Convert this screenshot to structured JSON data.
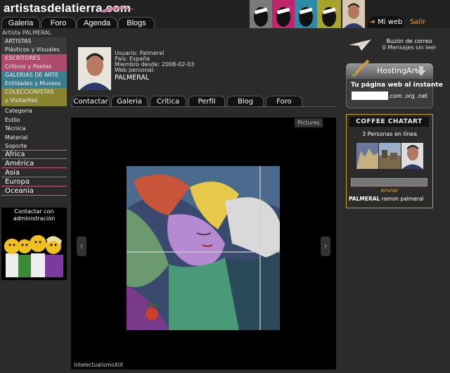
{
  "site": {
    "logo": "artistasdelatierra.com"
  },
  "topnav": [
    {
      "label": "Galeria"
    },
    {
      "label": "Foro"
    },
    {
      "label": "Agenda"
    },
    {
      "label": "Blogs"
    }
  ],
  "account": {
    "miweb_label": "Mi web",
    "salir_label": "Salir"
  },
  "breadcrumb": "Artista PALMERAL",
  "sections": [
    {
      "title": "ARTISTAS",
      "sub": "Plásticos y Visuales",
      "color": "#3a3a3a"
    },
    {
      "title": "ESCRITORES",
      "sub": "Críticos y Poetas",
      "color": "#b04a6e"
    },
    {
      "title": "GALERIAS DE ARTE",
      "sub": "Entidades y Museos",
      "color": "#3a7d8e"
    },
    {
      "title": "COLECCIONISTAS",
      "sub": "y Visitantes",
      "color": "#8a8430"
    }
  ],
  "filters": [
    "Categoria",
    "Estilo",
    "Técnica",
    "Material",
    "Soporte"
  ],
  "regions": [
    "África",
    "América",
    "Asia",
    "Europa",
    "Oceania"
  ],
  "contact": {
    "text": "Contactar con administración"
  },
  "profile": {
    "usuario": "Usuario: Palmeral",
    "pais": "País: España",
    "miembro": "Miembro desde: 2008-02-03",
    "web": "Web personal:",
    "name": "PALMERAL"
  },
  "profile_tabs": [
    {
      "label": "Contactar"
    },
    {
      "label": "Galeria"
    },
    {
      "label": "Crítica"
    },
    {
      "label": "Perfil"
    },
    {
      "label": "Blog"
    },
    {
      "label": "Foro"
    }
  ],
  "viewer": {
    "pictures_label": "Pictures",
    "caption": "IntelectualismoXIX",
    "prev_icon": "‹",
    "next_icon": "›"
  },
  "mailbox": {
    "title": "Buzón de correo",
    "status": "0 Mensajes sin leer"
  },
  "hosting": {
    "title": "HostingArt",
    "tagline": "Tu página web al instante",
    "domains": ".com .org .net"
  },
  "chat": {
    "logo": "COFFEE CHATART",
    "online": "3 Personas en línea",
    "send_label": "enviar",
    "user_bold": "PALMERAL",
    "user_rest": " ramon palmeral"
  }
}
